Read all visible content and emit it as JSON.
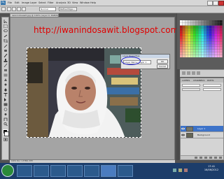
{
  "app": {
    "logo_label": "Ps"
  },
  "menu": [
    "File",
    "Edit",
    "Image",
    "Layer",
    "Select",
    "Filter",
    "Analysis",
    "3D",
    "View",
    "Window",
    "Help"
  ],
  "options_bar": {
    "style_select": "Normal",
    "refine_button": "Refine Edge..."
  },
  "document": {
    "tab_title": "iwanindosawit.jpg @ 100% (Layer 0, RGB/8)",
    "url_text": "http://iwanindosawit.blogspot.com",
    "status_text": "100%    Doc: 1.37M/1.37M"
  },
  "dialog": {
    "title": "Layer Properties",
    "field_value": "Layer Name: Layer 1",
    "ok_label": "OK",
    "cancel_label": "Cancel"
  },
  "layers": {
    "tabs": [
      "LAYERS",
      "CHANNELS",
      "PATHS"
    ],
    "rows": [
      {
        "name": "Layer 1",
        "selected": true
      },
      {
        "name": "Background",
        "selected": false
      }
    ]
  },
  "taskbar": {
    "time": "17:41",
    "date": "16/06/2012"
  },
  "colors": {
    "url_red": "#e00000",
    "selection_ring": "#2020d0",
    "layer_selected": "#3d73c9"
  }
}
